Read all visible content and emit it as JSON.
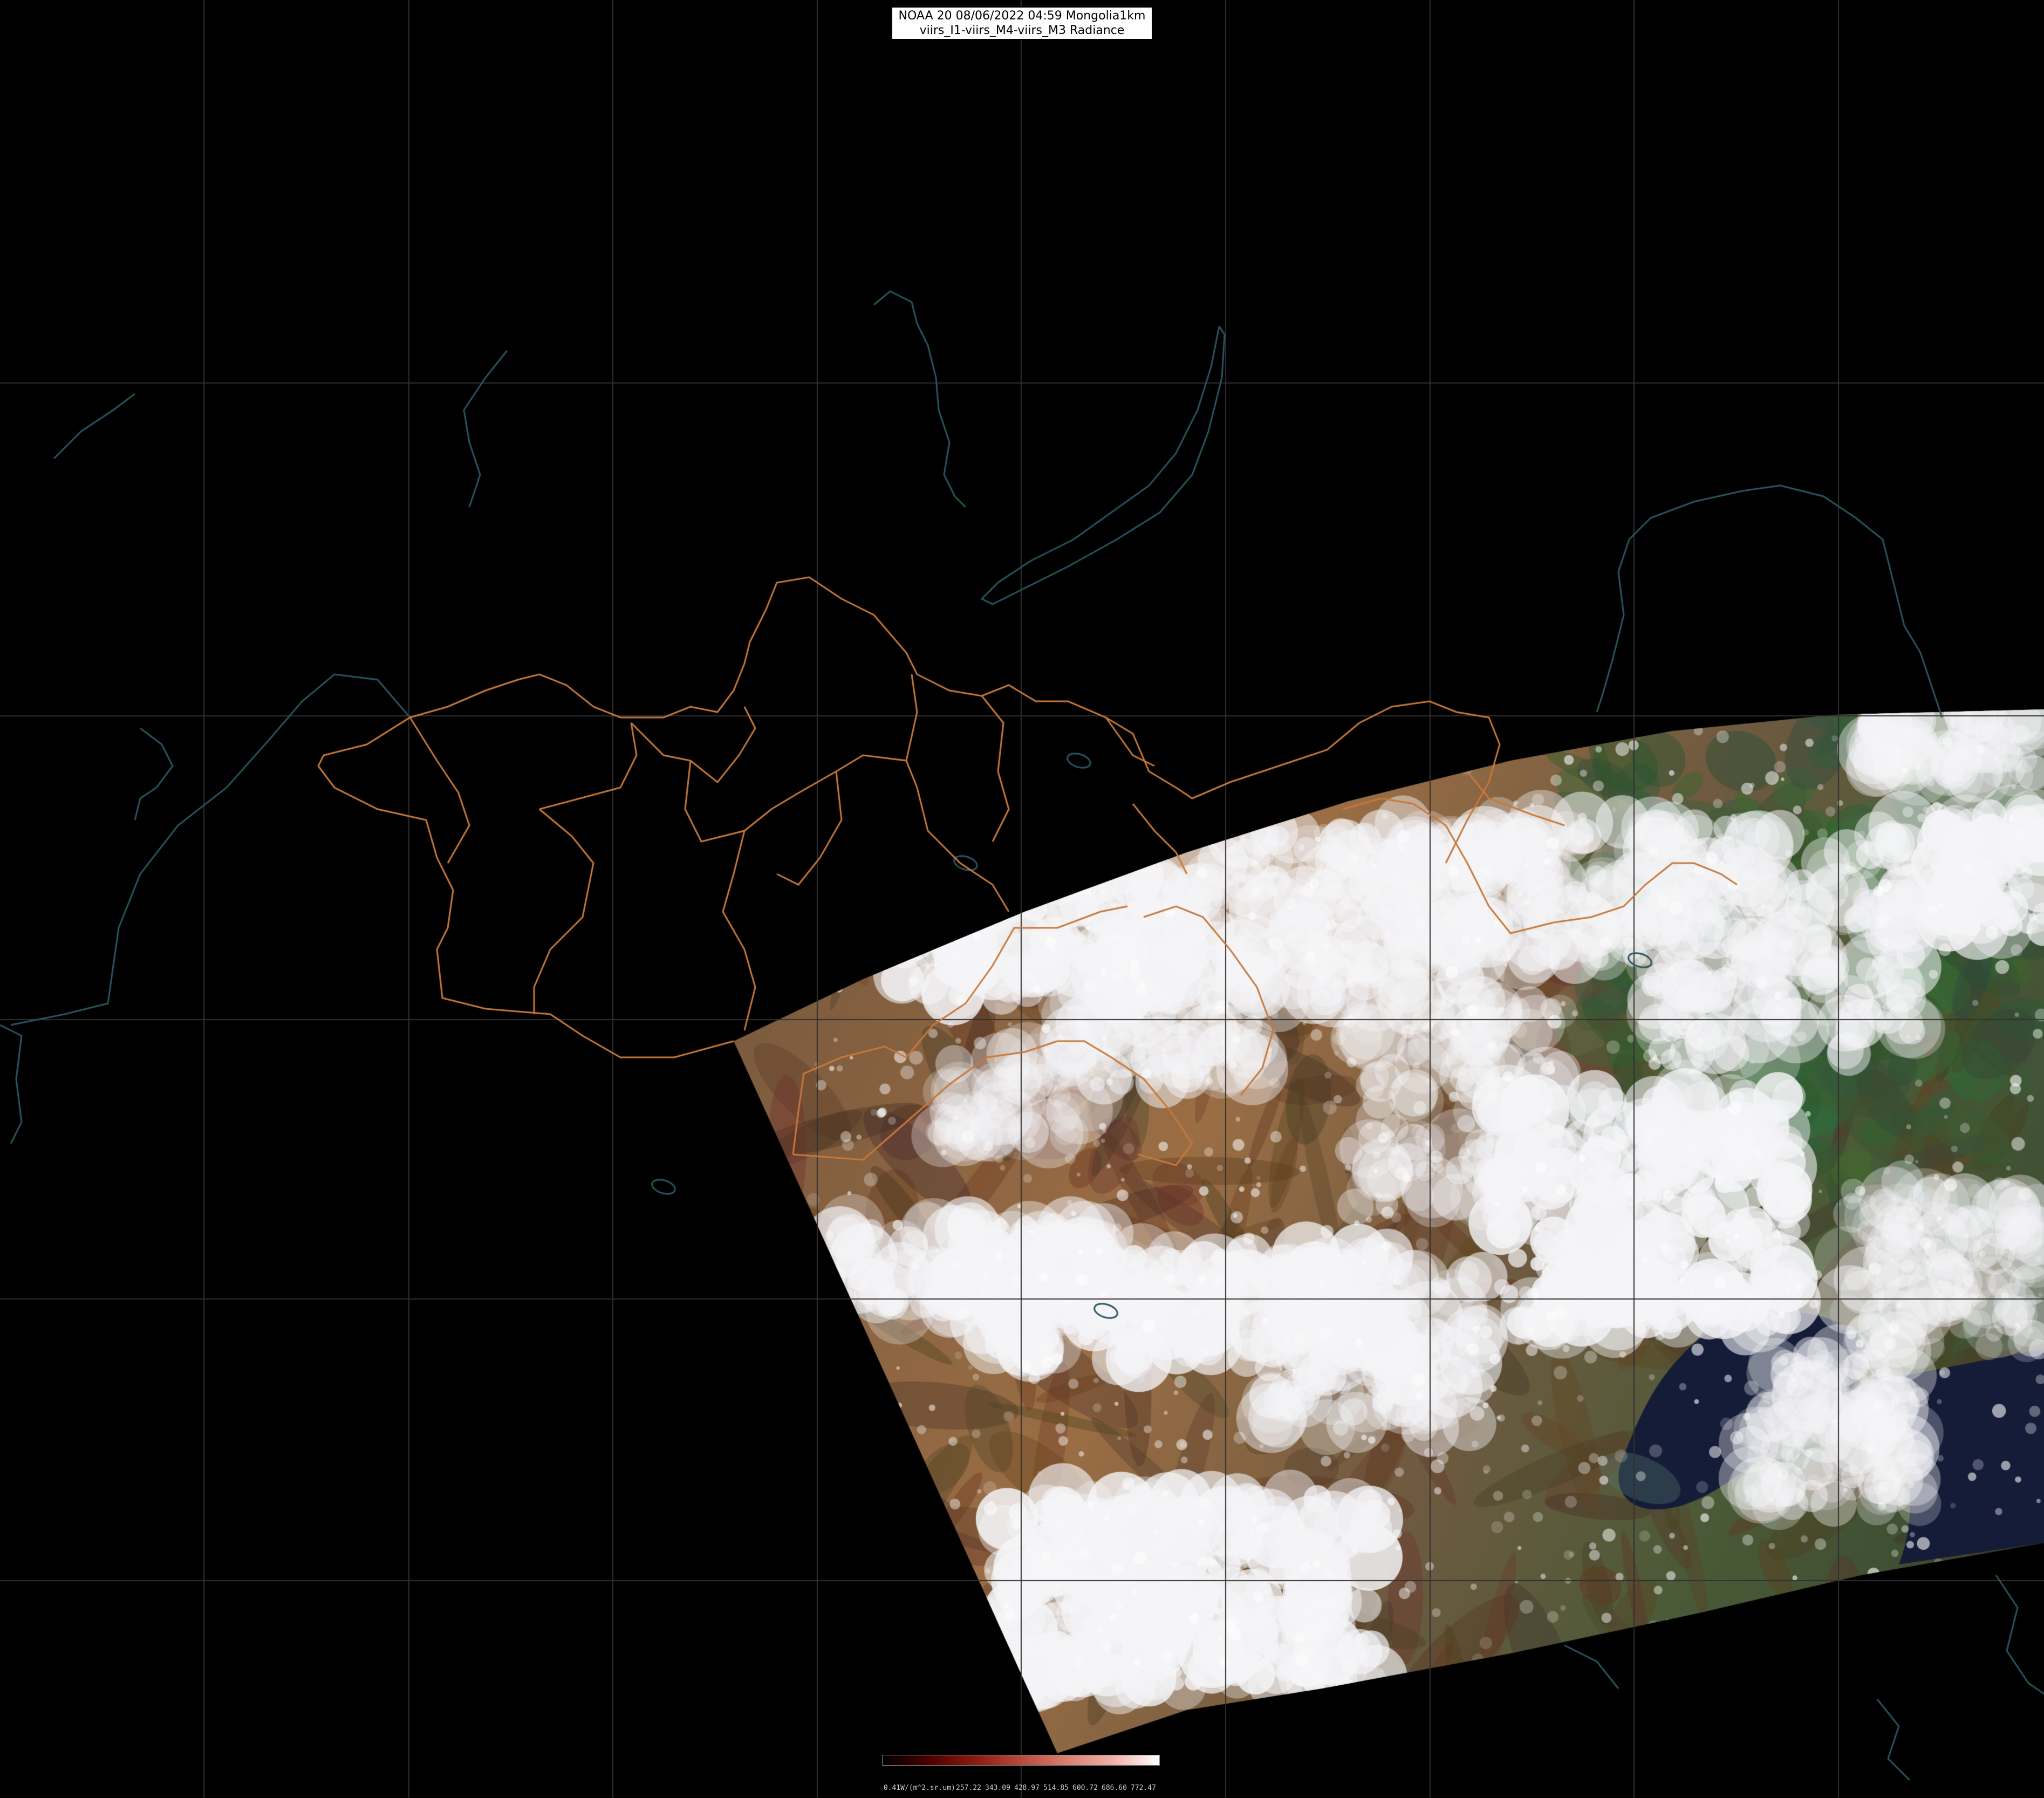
{
  "title": {
    "line1": "NOAA 20 08/06/2022 04:59 Mongolia1km",
    "line2": "viirs_I1-viirs_M4-viirs_M3 Radiance"
  },
  "colorbar": {
    "unit_label": "-0.41W/(m^2.sr.um)",
    "ticks": [
      "257.22",
      "343.09",
      "428.97",
      "514.85",
      "600.72",
      "686.60",
      "772.47"
    ],
    "colors": [
      "#000000",
      "#4a0000",
      "#8b1a10",
      "#b84a3a",
      "#d98070",
      "#f0b0a8",
      "#ffffff"
    ]
  },
  "map_style": {
    "background": "#000000",
    "graticule_color": "#303030",
    "border_color": "#c8783a",
    "coast_color": "#2a5560"
  }
}
